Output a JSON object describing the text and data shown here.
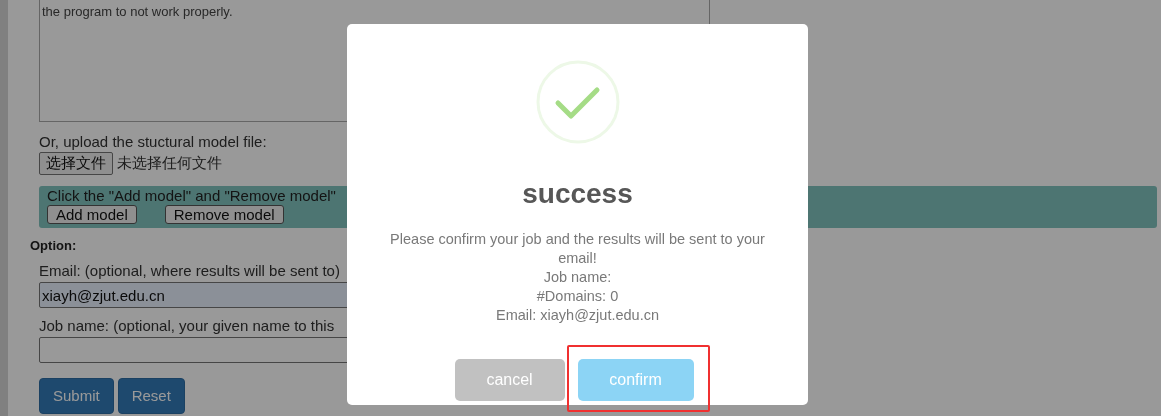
{
  "form": {
    "description_tail": "the program to not work properly.",
    "upload_label": "Or, upload the stuctural model file:",
    "file_button": "选择文件",
    "file_status": "未选择任何文件",
    "models_panel": {
      "hint": "Click the \"Add model\" and \"Remove model\"",
      "buttons": [
        "Add model",
        "Remove model"
      ]
    },
    "option_heading": "Option:",
    "fields": [
      {
        "label": "Email: (optional, where results will be sent to)",
        "value": "xiayh@zjut.edu.cn",
        "autofilled": true
      },
      {
        "label": "Job name: (optional, your given name to this",
        "autofilled": false
      }
    ],
    "buttons": [
      "Submit",
      "Reset"
    ]
  },
  "dialog": {
    "title": "success",
    "message_lines": [
      "Please confirm your job and the results will be sent to your email!",
      "Job name:",
      "#Domains: 0",
      "Email: xiayh@zjut.edu.cn"
    ],
    "buttons": [
      {
        "label": "cancel",
        "kind": "secondary",
        "highlighted": false
      },
      {
        "label": "confirm",
        "kind": "primary",
        "highlighted": true
      }
    ]
  }
}
